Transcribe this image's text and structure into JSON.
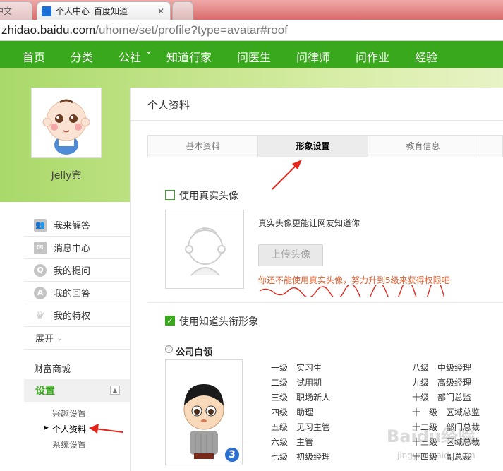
{
  "browser": {
    "tabs": [
      {
        "label": "中文"
      },
      {
        "label": "个人中心_百度知道",
        "close": "✕"
      },
      {
        "label": ""
      }
    ],
    "url_host": "zhidao.baidu.com",
    "url_path": "/uhome/set/profile?type=avatar#roof"
  },
  "nav": {
    "items": [
      "首页",
      "分类",
      "公社",
      "知道行家",
      "问医生",
      "问律师",
      "问作业",
      "经验"
    ],
    "dropdown_glyph": "⌄"
  },
  "profile": {
    "username": "Jelly宾"
  },
  "sidebar": {
    "items": [
      {
        "label": "我来解答",
        "icon": "users-icon"
      },
      {
        "label": "消息中心",
        "icon": "mail-icon"
      },
      {
        "label": "我的提问",
        "icon": "question-icon",
        "glyph": "Q"
      },
      {
        "label": "我的回答",
        "icon": "answer-icon",
        "glyph": "A"
      },
      {
        "label": "我的特权",
        "icon": "crown-icon",
        "glyph": "♛"
      },
      {
        "label": "展开",
        "icon": "expand-icon",
        "glyph": "⌄"
      }
    ],
    "mall": "财富商城",
    "settings": {
      "title": "设置",
      "collapse_glyph": "▲",
      "sub_items": [
        "兴趣设置",
        "个人资料",
        "系统设置"
      ]
    }
  },
  "main": {
    "title": "个人资料",
    "tabs": [
      "基本资料",
      "形象设置",
      "教育信息"
    ],
    "real_avatar": {
      "label": "使用真实头像",
      "hint": "真实头像更能让网友知道你",
      "upload_label": "上传头像",
      "warning": "你还不能使用真实头像，努力升到5级来获得权限吧"
    },
    "title_avatar": {
      "label": "使用知道头衔形象",
      "check_glyph": "✓",
      "category": "公司白领",
      "badge": "3",
      "levels_left": [
        {
          "level": "一级",
          "title": "实习生"
        },
        {
          "level": "二级",
          "title": "试用期"
        },
        {
          "level": "三级",
          "title": "职场新人"
        },
        {
          "level": "四级",
          "title": "助理"
        },
        {
          "level": "五级",
          "title": "见习主管"
        },
        {
          "level": "六级",
          "title": "主管"
        },
        {
          "level": "七级",
          "title": "初级经理"
        }
      ],
      "levels_right": [
        {
          "level": "八级",
          "title": "中级经理"
        },
        {
          "level": "九级",
          "title": "高级经理"
        },
        {
          "level": "十级",
          "title": "部门总监"
        },
        {
          "level": "十一级",
          "title": "区域总监"
        },
        {
          "level": "十二级",
          "title": "部门总裁"
        },
        {
          "level": "十三级",
          "title": "区域总裁"
        },
        {
          "level": "十四级",
          "title": "副总裁"
        }
      ]
    }
  },
  "watermark": {
    "text": "Baidu经验",
    "sub": "jingyan.baidu.com"
  },
  "colors": {
    "brand_green": "#3aa81d",
    "warning": "#e05c2c",
    "annotation_red": "#e3261c"
  }
}
